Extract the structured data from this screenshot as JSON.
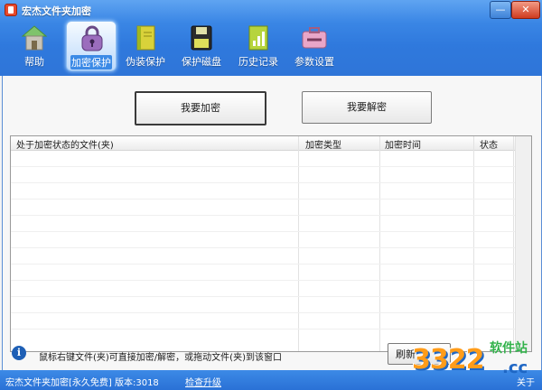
{
  "window": {
    "title": "宏杰文件夹加密",
    "minimize": "—",
    "close": "✕"
  },
  "toolbar": [
    {
      "label": "帮助",
      "icon": "house-icon"
    },
    {
      "label": "加密保护",
      "icon": "lock-bag-icon",
      "active": true
    },
    {
      "label": "伪装保护",
      "icon": "book-icon"
    },
    {
      "label": "保护磁盘",
      "icon": "disk-icon"
    },
    {
      "label": "历史记录",
      "icon": "history-icon"
    },
    {
      "label": "参数设置",
      "icon": "toolbox-icon"
    }
  ],
  "main": {
    "encrypt_button": "我要加密",
    "decrypt_button": "我要解密",
    "table": {
      "columns": [
        "处于加密状态的文件(夹)",
        "加密类型",
        "加密时间",
        "状态"
      ],
      "rows": []
    },
    "hint": "鼠标右键文件(夹)可直接加密/解密，或拖动文件(夹)到该窗口",
    "refresh_button": "刷新"
  },
  "statusbar": {
    "product": "宏杰文件夹加密[永久免费]  版本:3018",
    "check_update": "检查升级",
    "about": "关于"
  },
  "watermark": {
    "num": "3322",
    "site": "软件站",
    "domain": ".cc"
  },
  "colors": {
    "accent": "#2f79dd",
    "titlebar_top": "#5fa4f1",
    "status": "#2a71d6"
  }
}
